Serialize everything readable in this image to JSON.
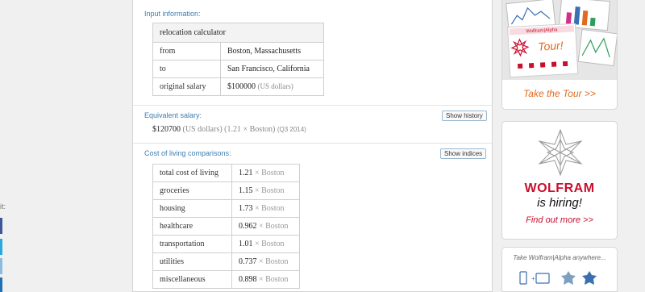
{
  "share": {
    "label": "it:"
  },
  "input": {
    "title": "Input information:",
    "header": "relocation calculator",
    "rows": [
      {
        "label": "from",
        "value": "Boston, Massachusetts",
        "unit": ""
      },
      {
        "label": "to",
        "value": "San Francisco, California",
        "unit": ""
      },
      {
        "label": "original salary",
        "value": "$100000",
        "unit": "(US dollars)"
      }
    ]
  },
  "equivalent": {
    "title": "Equivalent salary:",
    "button": "Show history",
    "value": "$120700",
    "unit": "(US dollars)",
    "ratio": "(1.21 × Boston)",
    "period": "(Q3 2014)"
  },
  "cost": {
    "title": "Cost of living comparisons:",
    "button": "Show indices",
    "rows": [
      {
        "label": "total cost of living",
        "value": "1.21",
        "ref": "× Boston"
      },
      {
        "label": "groceries",
        "value": "1.15",
        "ref": "× Boston"
      },
      {
        "label": "housing",
        "value": "1.73",
        "ref": "× Boston"
      },
      {
        "label": "healthcare",
        "value": "0.962",
        "ref": "× Boston"
      },
      {
        "label": "transportation",
        "value": "1.01",
        "ref": "× Boston"
      },
      {
        "label": "utilities",
        "value": "0.737",
        "ref": "× Boston"
      },
      {
        "label": "miscellaneous",
        "value": "0.898",
        "ref": "× Boston"
      }
    ]
  },
  "sidebar": {
    "tour": {
      "badge_brand": "Wolfram|Alpha",
      "badge_title": "Tour!",
      "link": "Take the Tour >>"
    },
    "hiring": {
      "brand": "WOLFRAM",
      "tagline": "is hiring!",
      "link": "Find out more >>"
    },
    "anywhere": {
      "text": "Take Wolfram|Alpha anywhere..."
    }
  },
  "colors": {
    "accent": "#3c7fb1",
    "brand_red": "#c8102e",
    "link_orange": "#e06a1e"
  }
}
